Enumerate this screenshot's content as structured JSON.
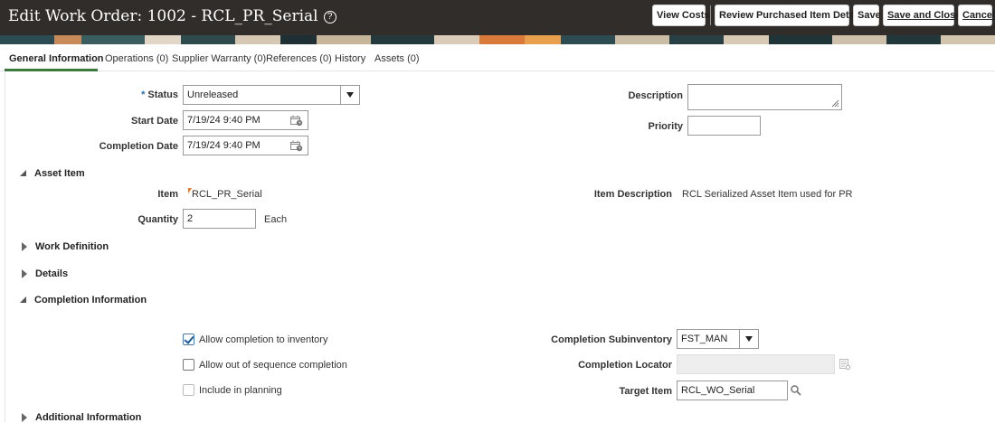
{
  "header": {
    "title": "Edit Work Order: 1002 - RCL_PR_Serial",
    "help_glyph": "?",
    "buttons": {
      "view_costs": "View Costs",
      "review_purchased": "Review Purchased Item Details",
      "save": "Save",
      "save_and_close": "Save and Close",
      "cancel": "Cancel"
    }
  },
  "tabs": [
    {
      "label": "General Information",
      "active": true
    },
    {
      "label": "Operations (0)"
    },
    {
      "label": "Supplier Warranty (0)"
    },
    {
      "label": "References (0)"
    },
    {
      "label": "History"
    },
    {
      "label": "Assets (0)"
    }
  ],
  "general": {
    "status_required_mark": "*",
    "status_label": "Status",
    "status_value": "Unreleased",
    "start_date_label": "Start Date",
    "start_date_value": "7/19/24 9:40 PM",
    "completion_date_label": "Completion Date",
    "completion_date_value": "7/19/24 9:40 PM",
    "description_label": "Description",
    "description_value": "",
    "priority_label": "Priority",
    "priority_value": ""
  },
  "asset_item": {
    "section_title": "Asset Item",
    "item_label": "Item",
    "item_value": "RCL_PR_Serial",
    "item_description_label": "Item Description",
    "item_description_value": "RCL Serialized Asset Item used for PR",
    "quantity_label": "Quantity",
    "quantity_value": "2",
    "uom": "Each"
  },
  "collapsed_sections": {
    "work_definition": "Work Definition",
    "details": "Details",
    "additional_information": "Additional Information"
  },
  "completion": {
    "section_title": "Completion Information",
    "allow_completion_label": "Allow completion to inventory",
    "allow_completion_checked": true,
    "allow_out_of_sequence_label": "Allow out of sequence completion",
    "allow_out_of_sequence_checked": false,
    "include_in_planning_label": "Include in planning",
    "include_in_planning_checked": false,
    "subinventory_label": "Completion Subinventory",
    "subinventory_value": "FST_MAN",
    "locator_label": "Completion Locator",
    "locator_value": "",
    "target_item_label": "Target Item",
    "target_item_value": "RCL_WO_Serial"
  },
  "colors": {
    "header_bg": "#312d2a",
    "active_tab_underline": "#3a7b3c",
    "required_mark": "#1a6fb5"
  }
}
